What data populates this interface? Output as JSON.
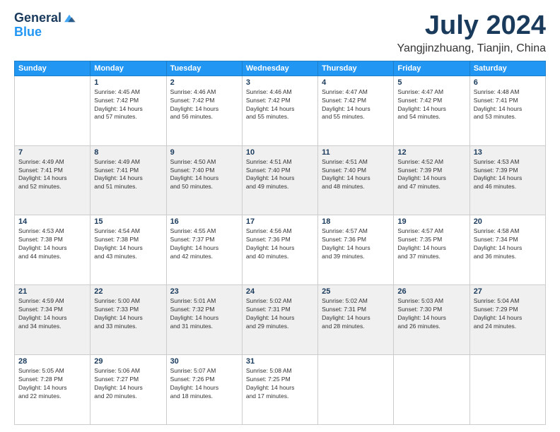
{
  "logo": {
    "general": "General",
    "blue": "Blue"
  },
  "title": {
    "month_year": "July 2024",
    "location": "Yangjinzhuang, Tianjin, China"
  },
  "headers": [
    "Sunday",
    "Monday",
    "Tuesday",
    "Wednesday",
    "Thursday",
    "Friday",
    "Saturday"
  ],
  "weeks": [
    [
      {
        "day": "",
        "info": ""
      },
      {
        "day": "1",
        "info": "Sunrise: 4:45 AM\nSunset: 7:42 PM\nDaylight: 14 hours\nand 57 minutes."
      },
      {
        "day": "2",
        "info": "Sunrise: 4:46 AM\nSunset: 7:42 PM\nDaylight: 14 hours\nand 56 minutes."
      },
      {
        "day": "3",
        "info": "Sunrise: 4:46 AM\nSunset: 7:42 PM\nDaylight: 14 hours\nand 55 minutes."
      },
      {
        "day": "4",
        "info": "Sunrise: 4:47 AM\nSunset: 7:42 PM\nDaylight: 14 hours\nand 55 minutes."
      },
      {
        "day": "5",
        "info": "Sunrise: 4:47 AM\nSunset: 7:42 PM\nDaylight: 14 hours\nand 54 minutes."
      },
      {
        "day": "6",
        "info": "Sunrise: 4:48 AM\nSunset: 7:41 PM\nDaylight: 14 hours\nand 53 minutes."
      }
    ],
    [
      {
        "day": "7",
        "info": "Sunrise: 4:49 AM\nSunset: 7:41 PM\nDaylight: 14 hours\nand 52 minutes."
      },
      {
        "day": "8",
        "info": "Sunrise: 4:49 AM\nSunset: 7:41 PM\nDaylight: 14 hours\nand 51 minutes."
      },
      {
        "day": "9",
        "info": "Sunrise: 4:50 AM\nSunset: 7:40 PM\nDaylight: 14 hours\nand 50 minutes."
      },
      {
        "day": "10",
        "info": "Sunrise: 4:51 AM\nSunset: 7:40 PM\nDaylight: 14 hours\nand 49 minutes."
      },
      {
        "day": "11",
        "info": "Sunrise: 4:51 AM\nSunset: 7:40 PM\nDaylight: 14 hours\nand 48 minutes."
      },
      {
        "day": "12",
        "info": "Sunrise: 4:52 AM\nSunset: 7:39 PM\nDaylight: 14 hours\nand 47 minutes."
      },
      {
        "day": "13",
        "info": "Sunrise: 4:53 AM\nSunset: 7:39 PM\nDaylight: 14 hours\nand 46 minutes."
      }
    ],
    [
      {
        "day": "14",
        "info": "Sunrise: 4:53 AM\nSunset: 7:38 PM\nDaylight: 14 hours\nand 44 minutes."
      },
      {
        "day": "15",
        "info": "Sunrise: 4:54 AM\nSunset: 7:38 PM\nDaylight: 14 hours\nand 43 minutes."
      },
      {
        "day": "16",
        "info": "Sunrise: 4:55 AM\nSunset: 7:37 PM\nDaylight: 14 hours\nand 42 minutes."
      },
      {
        "day": "17",
        "info": "Sunrise: 4:56 AM\nSunset: 7:36 PM\nDaylight: 14 hours\nand 40 minutes."
      },
      {
        "day": "18",
        "info": "Sunrise: 4:57 AM\nSunset: 7:36 PM\nDaylight: 14 hours\nand 39 minutes."
      },
      {
        "day": "19",
        "info": "Sunrise: 4:57 AM\nSunset: 7:35 PM\nDaylight: 14 hours\nand 37 minutes."
      },
      {
        "day": "20",
        "info": "Sunrise: 4:58 AM\nSunset: 7:34 PM\nDaylight: 14 hours\nand 36 minutes."
      }
    ],
    [
      {
        "day": "21",
        "info": "Sunrise: 4:59 AM\nSunset: 7:34 PM\nDaylight: 14 hours\nand 34 minutes."
      },
      {
        "day": "22",
        "info": "Sunrise: 5:00 AM\nSunset: 7:33 PM\nDaylight: 14 hours\nand 33 minutes."
      },
      {
        "day": "23",
        "info": "Sunrise: 5:01 AM\nSunset: 7:32 PM\nDaylight: 14 hours\nand 31 minutes."
      },
      {
        "day": "24",
        "info": "Sunrise: 5:02 AM\nSunset: 7:31 PM\nDaylight: 14 hours\nand 29 minutes."
      },
      {
        "day": "25",
        "info": "Sunrise: 5:02 AM\nSunset: 7:31 PM\nDaylight: 14 hours\nand 28 minutes."
      },
      {
        "day": "26",
        "info": "Sunrise: 5:03 AM\nSunset: 7:30 PM\nDaylight: 14 hours\nand 26 minutes."
      },
      {
        "day": "27",
        "info": "Sunrise: 5:04 AM\nSunset: 7:29 PM\nDaylight: 14 hours\nand 24 minutes."
      }
    ],
    [
      {
        "day": "28",
        "info": "Sunrise: 5:05 AM\nSunset: 7:28 PM\nDaylight: 14 hours\nand 22 minutes."
      },
      {
        "day": "29",
        "info": "Sunrise: 5:06 AM\nSunset: 7:27 PM\nDaylight: 14 hours\nand 20 minutes."
      },
      {
        "day": "30",
        "info": "Sunrise: 5:07 AM\nSunset: 7:26 PM\nDaylight: 14 hours\nand 18 minutes."
      },
      {
        "day": "31",
        "info": "Sunrise: 5:08 AM\nSunset: 7:25 PM\nDaylight: 14 hours\nand 17 minutes."
      },
      {
        "day": "",
        "info": ""
      },
      {
        "day": "",
        "info": ""
      },
      {
        "day": "",
        "info": ""
      }
    ]
  ]
}
